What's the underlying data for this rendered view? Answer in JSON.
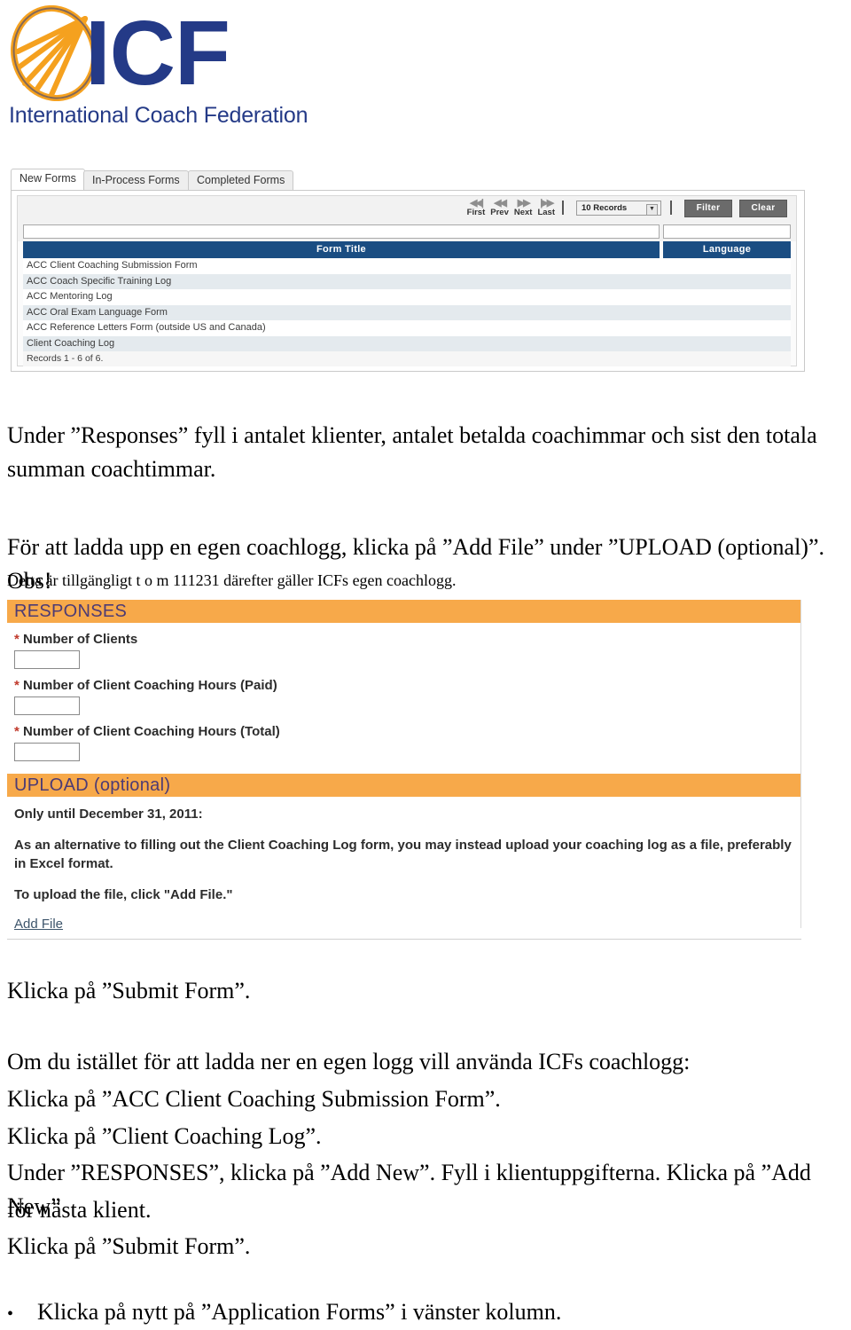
{
  "logo": {
    "mark_icon": "icf-leaf-logo",
    "wordmark": "ICF",
    "tagline": "International Coach Federation",
    "blue": "#243a87",
    "orange": "#f5a11f"
  },
  "forms_panel": {
    "tabs": [
      {
        "label": "New Forms",
        "active": true
      },
      {
        "label": "In-Process Forms",
        "active": false
      },
      {
        "label": "Completed Forms",
        "active": false
      }
    ],
    "toolbar": {
      "pager": [
        {
          "label": "First",
          "icon": "first-page-icon",
          "glyph": "◀◀|"
        },
        {
          "label": "Prev",
          "icon": "prev-page-icon",
          "glyph": "◀◀"
        },
        {
          "label": "Next",
          "icon": "next-page-icon",
          "glyph": "▶▶"
        },
        {
          "label": "Last",
          "icon": "last-page-icon",
          "glyph": "|▶▶"
        }
      ],
      "records_select": "10 Records",
      "records_caret_icon": "chevron-down-icon",
      "filter_label": "Filter",
      "clear_label": "Clear",
      "filter_value_title": "",
      "filter_value_language": ""
    },
    "columns": [
      "Form Title",
      "Language"
    ],
    "rows": [
      {
        "title": "ACC Client Coaching Submission Form",
        "language": ""
      },
      {
        "title": "ACC Coach Specific Training Log",
        "language": ""
      },
      {
        "title": "ACC Mentoring Log",
        "language": ""
      },
      {
        "title": "ACC Oral Exam Language Form",
        "language": ""
      },
      {
        "title": "ACC Reference Letters Form (outside US and Canada)",
        "language": ""
      },
      {
        "title": "Client Coaching Log",
        "language": ""
      }
    ],
    "footer": "Records 1 - 6 of 6.",
    "header_color": "#1a4d82",
    "alt_row_color": "#e4eaee"
  },
  "prose": {
    "para1_line1": "Under ”Responses” fyll i antalet klienter, antalet betalda coachimmar och sist den totala",
    "para1_line2": "summan coachtimmar.",
    "para2_line1": "För att ladda upp en egen coachlogg, klicka på ”Add File” under ”UPLOAD (optional)”. Obs!",
    "para2_line2": "Detta är tillgängligt t o m 111231 därefter gäller ICFs egen coachlogg.",
    "para3": "Klicka på ”Submit Form”.",
    "para4": "Om du istället för att ladda ner en egen logg vill använda ICFs coachlogg:",
    "para5": "Klicka på ”ACC Client Coaching Submission Form”.",
    "para6": "Klicka på ”Client Coaching Log”.",
    "para7_line1": "Under ”RESPONSES”, klicka på ”Add New”. Fyll i klientuppgifterna. Klicka på ”Add New”",
    "para7_line2": "för nästa klient.",
    "para8": "Klicka på ”Submit Form”.",
    "bullet_dot": "•",
    "bullet1": "Klicka på nytt på ”Application Forms” i vänster kolumn."
  },
  "responses_form": {
    "section_title": "RESPONSES",
    "section_color": "#f7a94a",
    "section_text_color": "#4d3b74",
    "required_marker": "*",
    "fields": [
      {
        "label": "Number of Clients",
        "value": ""
      },
      {
        "label": "Number of Client Coaching Hours (Paid)",
        "value": ""
      },
      {
        "label": "Number of Client Coaching Hours (Total)",
        "value": ""
      }
    ]
  },
  "upload_section": {
    "section_title": "UPLOAD (optional)",
    "deadline_text": "Only until December 31, 2011:",
    "body_line1": "As an alternative to filling out the Client Coaching Log form, you may instead upload your coaching log as a file, preferably",
    "body_line2": "in Excel format.",
    "instruction": "To upload the file, click \"Add File.\"",
    "add_file_label": "Add File"
  }
}
